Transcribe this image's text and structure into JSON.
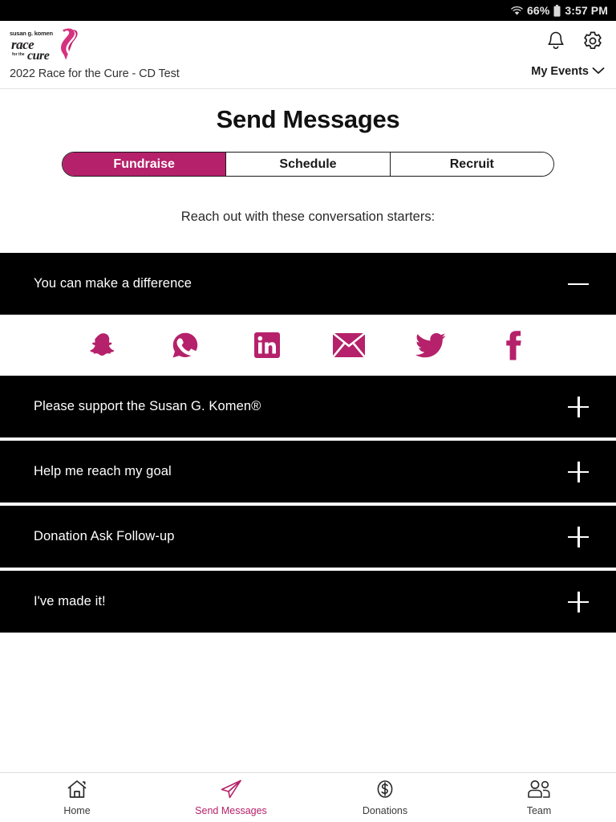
{
  "status_bar": {
    "wifi_icon": "wifi-icon",
    "battery_percent": "66%",
    "battery_icon": "battery-icon",
    "time": "3:57 PM"
  },
  "header": {
    "logo": {
      "icon": "komen-ribbon-icon",
      "line1": "susan g. komen",
      "line2": "race",
      "line3_small": "for the",
      "line3": "cure",
      "alt": "Susan G. Komen Race for the Cure logo"
    },
    "event_title": "2022 Race for the Cure - CD Test",
    "notification_icon": "bell-icon",
    "settings_icon": "gear-icon",
    "my_events_label": "My Events",
    "my_events_chevron": "chevron-down-icon"
  },
  "main": {
    "page_title": "Send Messages",
    "tabs": [
      {
        "label": "Fundraise",
        "active": true
      },
      {
        "label": "Schedule",
        "active": false
      },
      {
        "label": "Recruit",
        "active": false
      }
    ],
    "subtitle": "Reach out with these conversation starters:",
    "accordion": [
      {
        "title": "You can make a difference",
        "expanded": true,
        "toggle_icon": "minus-icon",
        "share_options": [
          {
            "name": "snapchat-icon",
            "label": "Snapchat"
          },
          {
            "name": "whatsapp-icon",
            "label": "WhatsApp"
          },
          {
            "name": "linkedin-icon",
            "label": "LinkedIn"
          },
          {
            "name": "email-icon",
            "label": "Email"
          },
          {
            "name": "twitter-icon",
            "label": "Twitter"
          },
          {
            "name": "facebook-icon",
            "label": "Facebook"
          }
        ]
      },
      {
        "title": "Please support the Susan G. Komen®",
        "expanded": false,
        "toggle_icon": "plus-icon"
      },
      {
        "title": "Help me reach my goal",
        "expanded": false,
        "toggle_icon": "plus-icon"
      },
      {
        "title": "Donation Ask Follow-up",
        "expanded": false,
        "toggle_icon": "plus-icon"
      },
      {
        "title": "I've made it!",
        "expanded": false,
        "toggle_icon": "plus-icon"
      }
    ]
  },
  "bottom_nav": [
    {
      "label": "Home",
      "icon": "home-icon",
      "active": false
    },
    {
      "label": "Send Messages",
      "icon": "paper-plane-icon",
      "active": true
    },
    {
      "label": "Donations",
      "icon": "dollar-coin-icon",
      "active": false
    },
    {
      "label": "Team",
      "icon": "people-icon",
      "active": false
    }
  ],
  "colors": {
    "accent": "#b5216a",
    "panel_black": "#000000",
    "background": "#ffffff",
    "status_bar": "#000000"
  }
}
